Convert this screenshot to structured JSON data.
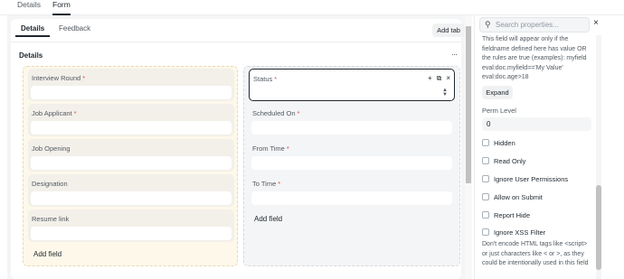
{
  "top_tabs": [
    "Details",
    "Form"
  ],
  "form": {
    "sub_tabs": [
      "Details",
      "Feedback"
    ],
    "add_tab_label": "Add tab",
    "section_title": "Details",
    "section_menu": "···",
    "left_column": {
      "fields": [
        {
          "label": "Interview Round",
          "required": "*"
        },
        {
          "label": "Job Applicant",
          "required": "*"
        },
        {
          "label": "Job Opening",
          "required": ""
        },
        {
          "label": "Designation",
          "required": ""
        },
        {
          "label": "Resume link",
          "required": ""
        }
      ],
      "add_field": "Add field"
    },
    "right_column": {
      "fields": [
        {
          "label": "Status",
          "required": "*"
        },
        {
          "label": "Scheduled On",
          "required": "*"
        },
        {
          "label": "From Time",
          "required": "*"
        },
        {
          "label": "To Time",
          "required": "*"
        }
      ],
      "add_field": "Add field"
    },
    "field_tools": {
      "add": "+",
      "duplicate": "⧉",
      "remove": "×"
    }
  },
  "properties": {
    "search_placeholder": "Search properties...",
    "close": "×",
    "depends_on_help": "This field will appear only if the fieldname defined here has value OR the rules are true (examples): myfield eval:doc.myfield=='My Value' eval:doc.age>18",
    "expand_label": "Expand",
    "perm_level_label": "Perm Level",
    "perm_level_value": "0",
    "checkboxes": [
      "Hidden",
      "Read Only",
      "Ignore User Permissions",
      "Allow on Submit",
      "Report Hide",
      "Ignore XSS Filter"
    ],
    "xss_help": "Don't encode HTML tags like <script> or just characters like < or >, as they could be intentionally used in this field"
  },
  "colors": {
    "accent": "#1f272e",
    "required": "#e24c4c",
    "left_column_bg": "#fdf8ea"
  }
}
